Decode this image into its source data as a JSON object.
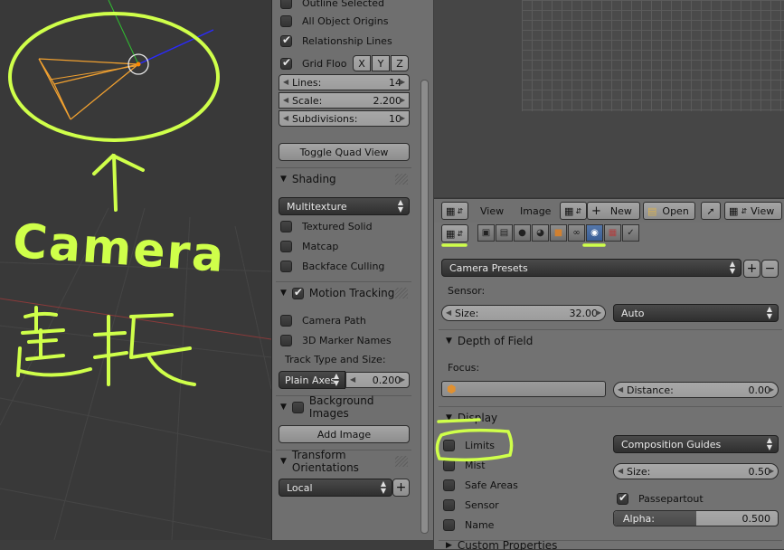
{
  "viewport": {
    "annotation_word": "Camera",
    "annotation_cjk": "選択"
  },
  "npanel": {
    "outline_selected": "Outline Selected",
    "all_object_origins": "All Object Origins",
    "relationship_lines": "Relationship Lines",
    "grid_floor": "Grid Floo",
    "axis_x": "X",
    "axis_y": "Y",
    "axis_z": "Z",
    "lines_label": "Lines:",
    "lines_value": "14",
    "scale_label": "Scale:",
    "scale_value": "2.200",
    "subdiv_label": "Subdivisions:",
    "subdiv_value": "10",
    "toggle_quad": "Toggle Quad View",
    "shading_header": "Shading",
    "shading_mode": "Multitexture",
    "textured_solid": "Textured Solid",
    "matcap": "Matcap",
    "backface_culling": "Backface Culling",
    "motion_tracking_header": "Motion Tracking",
    "camera_path": "Camera Path",
    "marker_names": "3D Marker Names",
    "track_type_label": "Track Type and Size:",
    "track_type_value": "Plain Axes",
    "track_size_value": "0.200",
    "bg_images_header": "Background Images",
    "add_image": "Add Image",
    "transform_orient_header": "Transform Orientations",
    "orientation_value": "Local"
  },
  "image_header": {
    "view_menu": "View",
    "image_menu": "Image",
    "new_button": "New",
    "open_button": "Open",
    "view_button": "View"
  },
  "props": {
    "camera_presets": "Camera Presets",
    "sensor_label": "Sensor:",
    "size_label": "Size:",
    "size_value": "32.00",
    "sensor_fit": "Auto",
    "dof_header": "Depth of Field",
    "focus_label": "Focus:",
    "distance_label": "Distance:",
    "distance_value": "0.00",
    "display_header": "Display",
    "limits": "Limits",
    "mist": "Mist",
    "safe_areas": "Safe Areas",
    "sensor": "Sensor",
    "name": "Name",
    "composition_guides": "Composition Guides",
    "disp_size_label": "Size:",
    "disp_size_value": "0.50",
    "passepartout": "Passepartout",
    "alpha_label": "Alpha:",
    "alpha_value": "0.500",
    "alpha_fraction": 0.5,
    "next_header": "Custom Properties"
  },
  "colors": {
    "annotation": "#cfff4a",
    "camera": "#f0a030",
    "active_tab": "#3a5f96"
  }
}
